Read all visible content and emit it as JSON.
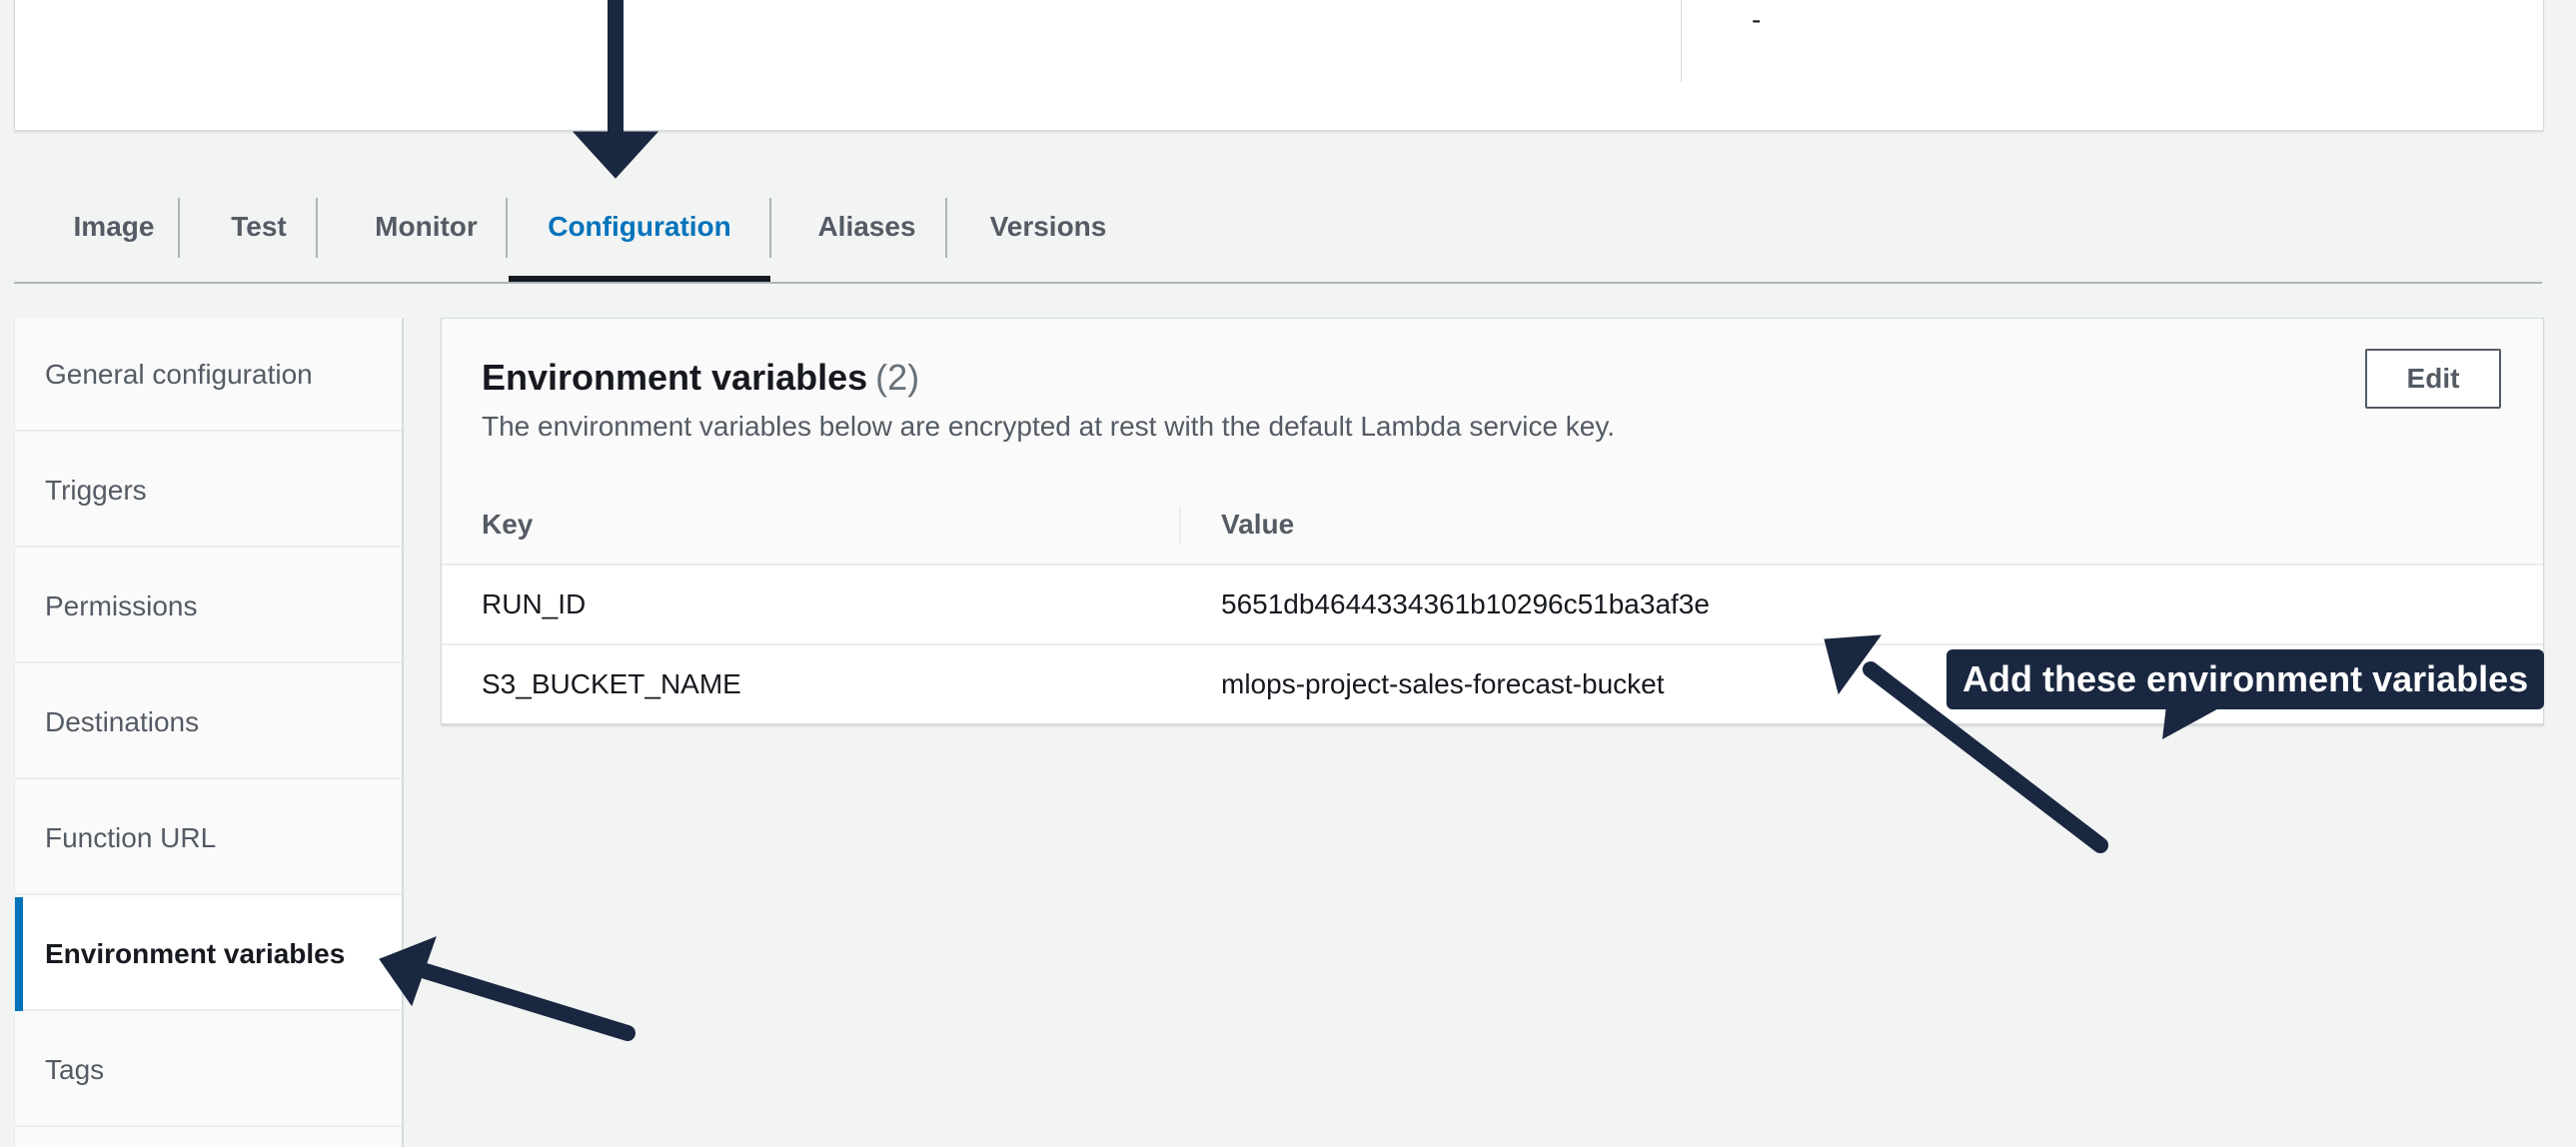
{
  "top_card": {
    "value": "-"
  },
  "tabs": [
    {
      "label": "Image"
    },
    {
      "label": "Test"
    },
    {
      "label": "Monitor"
    },
    {
      "label": "Configuration"
    },
    {
      "label": "Aliases"
    },
    {
      "label": "Versions"
    }
  ],
  "active_tab": "Configuration",
  "side_nav": [
    {
      "label": "General configuration"
    },
    {
      "label": "Triggers"
    },
    {
      "label": "Permissions"
    },
    {
      "label": "Destinations"
    },
    {
      "label": "Function URL"
    },
    {
      "label": "Environment variables"
    },
    {
      "label": "Tags"
    }
  ],
  "active_nav": "Environment variables",
  "panel": {
    "title": "Environment variables",
    "count": "(2)",
    "description": "The environment variables below are encrypted at rest with the default Lambda service key.",
    "edit_label": "Edit",
    "columns": [
      "Key",
      "Value"
    ],
    "rows": [
      {
        "key": "RUN_ID",
        "value": "5651db4644334361b10296c51ba3af3e"
      },
      {
        "key": "S3_BUCKET_NAME",
        "value": "mlops-project-sales-forecast-bucket"
      }
    ]
  },
  "annotation": {
    "callout_text": "Add these environment variables"
  },
  "colors": {
    "accent": "#0073bb",
    "annotation": "#1a2740",
    "background": "#f2f3f3"
  },
  "icons": {
    "arrows": "arrow-icon"
  }
}
